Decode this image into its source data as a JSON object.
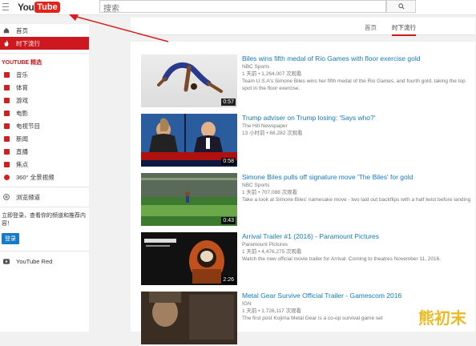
{
  "header": {
    "logo_you": "You",
    "logo_tube": "Tube",
    "search_placeholder": "搜索"
  },
  "sidebar": {
    "home": "首页",
    "trending": "时下流行",
    "section_title": "YOUTUBE 精选",
    "items": [
      {
        "label": "音乐",
        "icon": "music-icon"
      },
      {
        "label": "体育",
        "icon": "sports-icon"
      },
      {
        "label": "游戏",
        "icon": "gaming-icon"
      },
      {
        "label": "电影",
        "icon": "movies-icon"
      },
      {
        "label": "电视节目",
        "icon": "tv-icon"
      },
      {
        "label": "新闻",
        "icon": "news-icon"
      },
      {
        "label": "直播",
        "icon": "live-icon"
      },
      {
        "label": "焦点",
        "icon": "spotlight-icon"
      },
      {
        "label": "360° 全景视频",
        "icon": "360-icon"
      }
    ],
    "browse_channels": "浏览频道",
    "signin_text": "立即登录，查看你的频道和推荐内容！",
    "signin_button": "登录",
    "youtube_red": "YouTube Red"
  },
  "tabs": {
    "home": "首页",
    "trending": "时下流行"
  },
  "videos": [
    {
      "title": "Biles wins fifth medal of Rio Games with floor exercise gold",
      "channel": "NBC Sports",
      "meta": "1 天前 • 1,264,007 次观看",
      "desc": "Team U.S.A's Simone Biles wins her fifth medal of the Rio Games, and fourth gold, taking the top spot in the floor exercise.",
      "duration": "0:57"
    },
    {
      "title": "Trump adviser on Trump losing: 'Says who?'",
      "channel": "The Hill Newspaper",
      "meta": "13 小时前 • 68,282 次观看",
      "desc": "",
      "duration": "0:58"
    },
    {
      "title": "Simone Biles pulls off signature move 'The Biles' for gold",
      "channel": "NBC Sports",
      "meta": "1 天前 • 707,088 次观看",
      "desc": "Take a look at Simone Biles' namesake move - two laid out backflips with a half twist before landing",
      "duration": "0:43"
    },
    {
      "title": "Arrival Trailer #1 (2016) - Paramount Pictures",
      "channel": "Paramount Pictures",
      "meta": "1 天前 • 4,476,275 次观看",
      "desc": "Watch the new official movie trailer for Arrival. Coming to theatres November 11, 2016.",
      "duration": "2:26"
    },
    {
      "title": "Metal Gear Survive Official Trailer - Gamescom 2016",
      "channel": "IGN",
      "meta": "1 天前 • 1,726,117 次观看",
      "desc": "The first post Kojima Metal Gear is a co-op survival game set",
      "duration": ""
    }
  ],
  "watermark": "熊初末"
}
